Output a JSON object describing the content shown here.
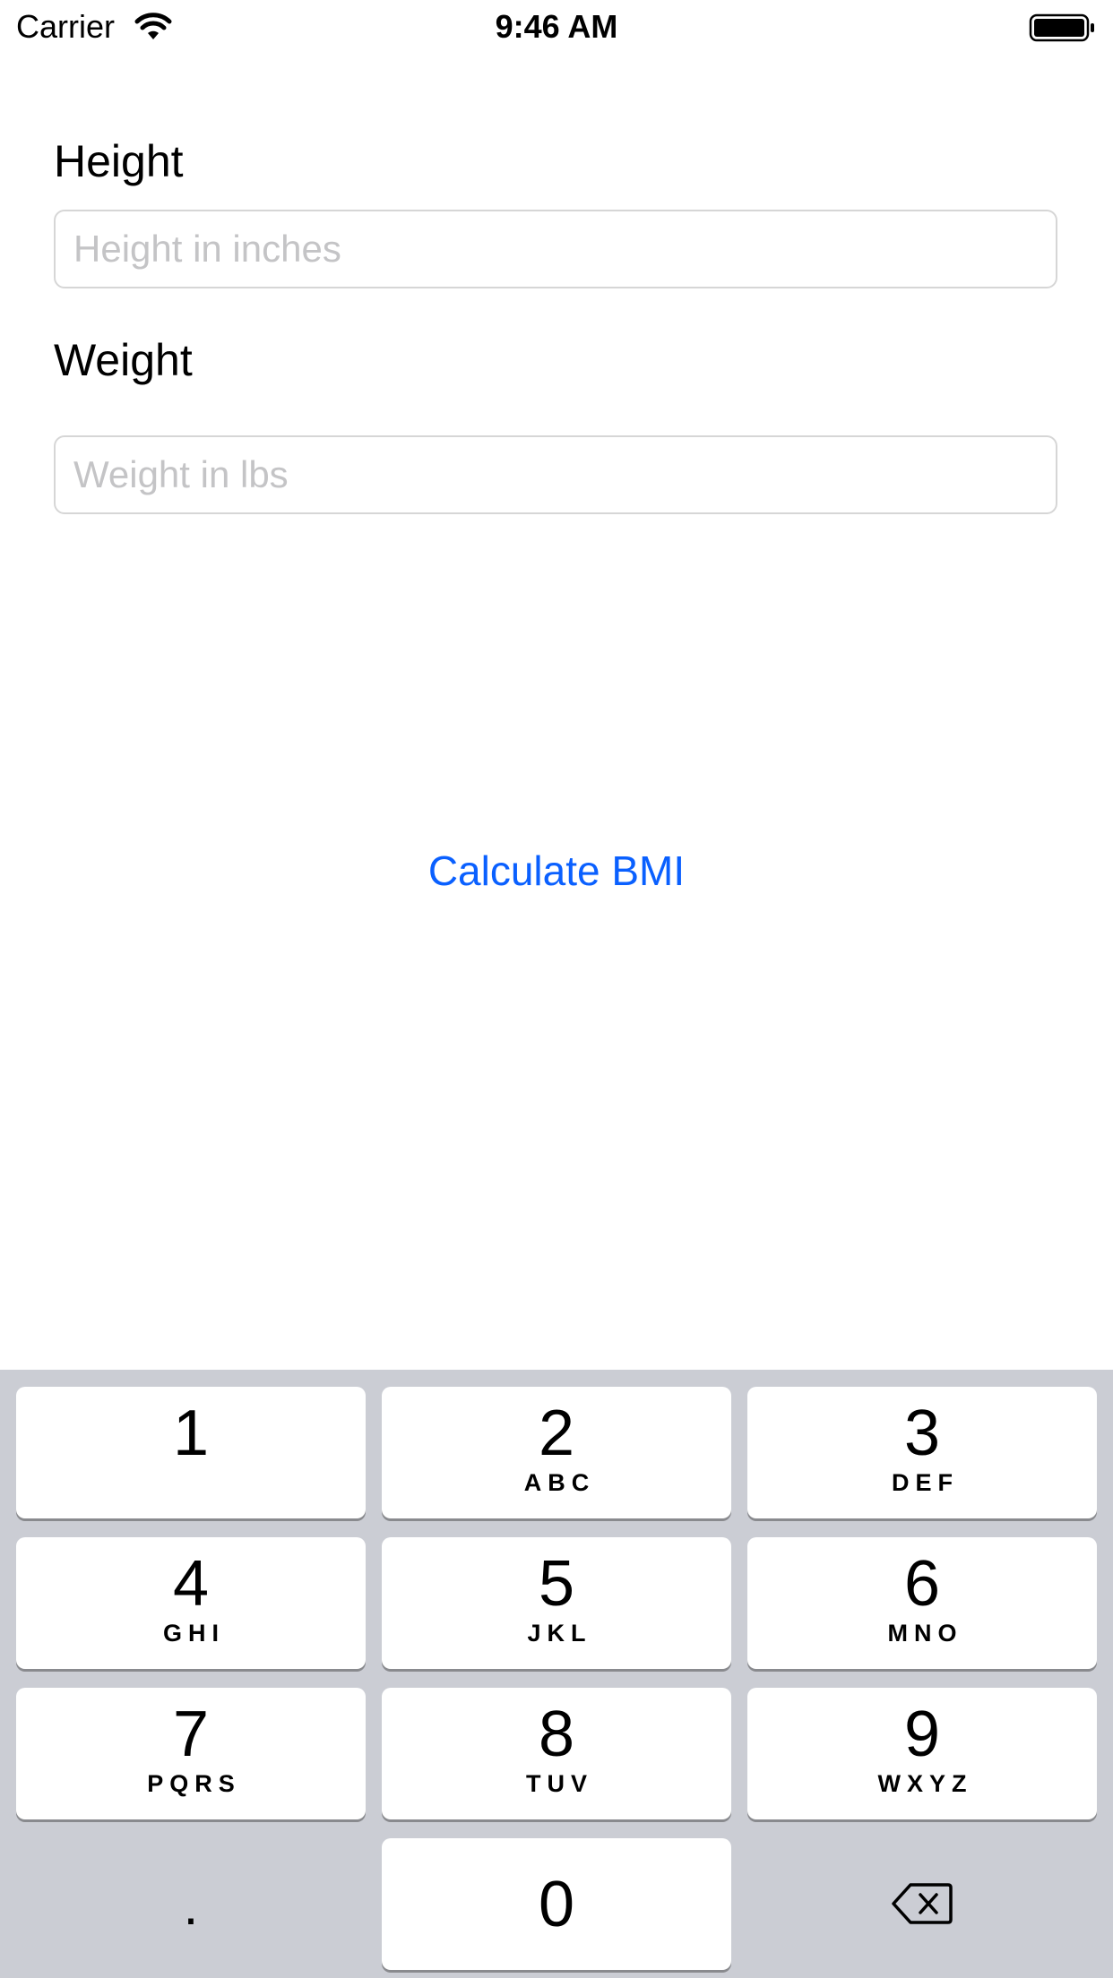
{
  "status_bar": {
    "carrier": "Carrier",
    "time": "9:46 AM",
    "icons": [
      "wifi-icon",
      "battery-icon"
    ]
  },
  "form": {
    "height_label": "Height",
    "height_placeholder": "Height in inches",
    "height_value": "",
    "weight_label": "Weight",
    "weight_placeholder": "Weight in lbs",
    "weight_value": "",
    "calculate_label": "Calculate BMI"
  },
  "keypad": {
    "keys": [
      {
        "digit": "1",
        "letters": ""
      },
      {
        "digit": "2",
        "letters": "ABC"
      },
      {
        "digit": "3",
        "letters": "DEF"
      },
      {
        "digit": "4",
        "letters": "GHI"
      },
      {
        "digit": "5",
        "letters": "JKL"
      },
      {
        "digit": "6",
        "letters": "MNO"
      },
      {
        "digit": "7",
        "letters": "PQRS"
      },
      {
        "digit": "8",
        "letters": "TUV"
      },
      {
        "digit": "9",
        "letters": "WXYZ"
      },
      {
        "digit": "0",
        "letters": ""
      }
    ],
    "decimal": ".",
    "delete_icon": "backspace-icon"
  },
  "colors": {
    "accent": "#0a60ff",
    "keypad_background": "#cbcdd4",
    "key_background": "#ffffff",
    "placeholder": "#c4c4c6"
  }
}
